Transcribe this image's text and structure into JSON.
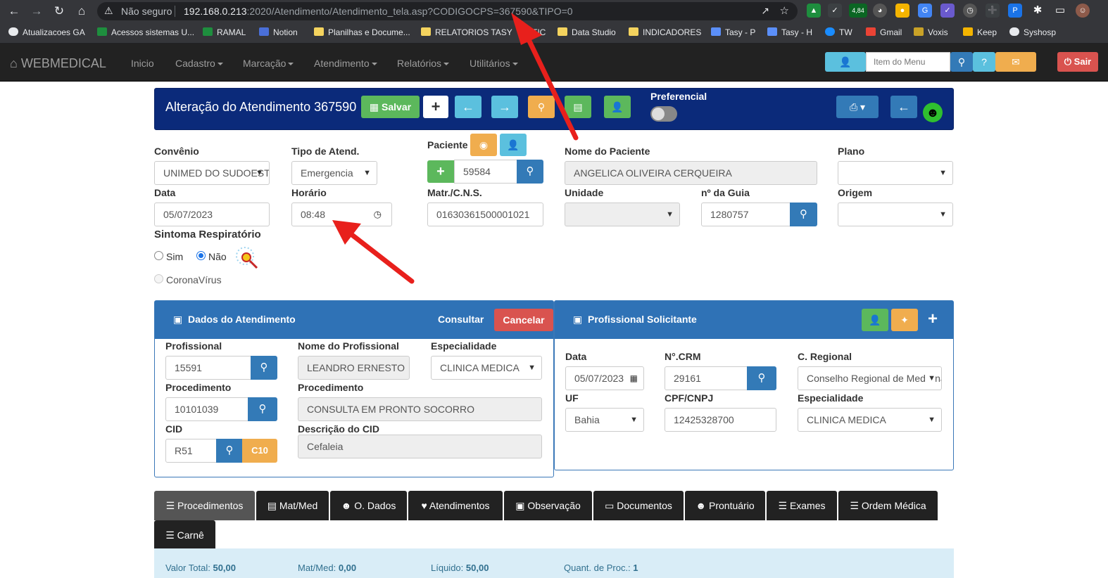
{
  "browser": {
    "insecure_label": "Não seguro",
    "url_host": "192.168.0.213",
    "url_rest": ":2020/Atendimento/Atendimento_tela.asp?CODIGOCPS=367590&TIPO=0",
    "ext_badge": "4,84",
    "bookmarks": [
      "Atualizacoes GA",
      "Acessos sistemas U...",
      "RAMAL",
      "Notion",
      "Planilhas e Docume...",
      "RELATORIOS TASY",
      "TIC",
      "Data Studio",
      "INDICADORES",
      "Tasy - P",
      "Tasy - H",
      "TW",
      "Gmail",
      "Voxis",
      "Keep",
      "Syshosp"
    ]
  },
  "nav": {
    "brand": "WEBMEDICAL",
    "items": [
      "Inicio",
      "Cadastro",
      "Marcação",
      "Atendimento",
      "Relatórios",
      "Utilitários"
    ],
    "search_placeholder": "Item do Menu",
    "exit_label": "Sair"
  },
  "header": {
    "title": "Alteração do Atendimento 367590",
    "save_label": "Salvar",
    "preferencial_label": "Preferencial"
  },
  "form": {
    "convenio_label": "Convênio",
    "convenio_value": "UNIMED DO SUDOESTE",
    "tipo_label": "Tipo de Atend.",
    "tipo_value": "Emergencia",
    "paciente_label": "Paciente",
    "paciente_value": "59584",
    "nome_label": "Nome do Paciente",
    "nome_value": "ANGELICA OLIVEIRA CERQUEIRA",
    "plano_label": "Plano",
    "data_label": "Data",
    "data_value": "05/07/2023",
    "horario_label": "Horário",
    "horario_value": "08:48",
    "matr_label": "Matr./C.N.S.",
    "matr_value": "01630361500001021",
    "unidade_label": "Unidade",
    "guia_label": "nº da Guia",
    "guia_value": "1280757",
    "origem_label": "Origem",
    "sintoma_label": "Sintoma Respiratório",
    "sim_label": "Sim",
    "nao_label": "Não",
    "corona_label": "CoronaVírus"
  },
  "dados": {
    "title": "Dados do Atendimento",
    "consultar_label": "Consultar",
    "cancelar_label": "Cancelar",
    "prof_label": "Profissional",
    "prof_value": "15591",
    "nome_prof_label": "Nome do Profissional",
    "nome_prof_value": "LEANDRO ERNESTO",
    "esp_label": "Especialidade",
    "esp_value": "CLINICA MEDICA",
    "proc_label": "Procedimento",
    "proc_value": "10101039",
    "proc_desc_label": "Procedimento",
    "proc_desc_value": "CONSULTA EM PRONTO SOCORRO",
    "cid_label": "CID",
    "cid_value": "R51",
    "cid_btn": "C10",
    "cid_desc_label": "Descrição do CID",
    "cid_desc_value": "Cefaleia"
  },
  "solicitante": {
    "title": "Profissional Solicitante",
    "data_label": "Data",
    "data_value": "05/07/2023",
    "crm_label": "N°.CRM",
    "crm_value": "29161",
    "regional_label": "C. Regional",
    "regional_value": "Conselho Regional de Medicina",
    "uf_label": "UF",
    "uf_value": "Bahia",
    "cpf_label": "CPF/CNPJ",
    "cpf_value": "12425328700",
    "esp_label": "Especialidade",
    "esp_value": "CLINICA MEDICA"
  },
  "tabs": [
    "Procedimentos",
    "Mat/Med",
    "O. Dados",
    "Atendimentos",
    "Observação",
    "Documentos",
    "Prontuário",
    "Exames",
    "Ordem Médica",
    "Carnê"
  ],
  "summary": {
    "total_label": "Valor Total:",
    "total_value": "50,00",
    "matmed_label": "Mat/Med:",
    "matmed_value": "0,00",
    "liquido_label": "Líquido:",
    "liquido_value": "50,00",
    "quant_label": "Quant. de Proc.:",
    "quant_value": "1"
  },
  "colors": {
    "header_blue": "#0b2a7a",
    "panel_blue": "#2f72b6",
    "arrow_red": "#e8201c"
  }
}
